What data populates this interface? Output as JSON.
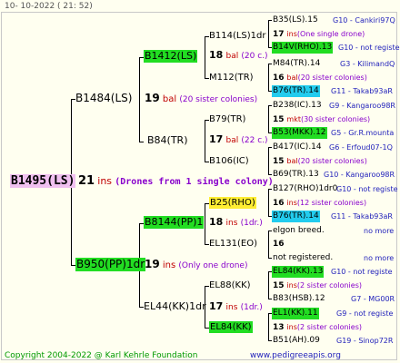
{
  "header_date": "10-  10-2022  ( 21: 52)",
  "footer": {
    "copyright": "Copyright 2004-2022 @ Karl Kehrle Foundation",
    "url": "www.pedigreeapis.org"
  },
  "root": {
    "name": "B1495(LS)",
    "count": "21",
    "unit": "ins",
    "note": "(Drones from 1 single colony)"
  },
  "gen1": [
    {
      "name": "B1484(LS)",
      "count": "19",
      "unit": "bal",
      "note": "(20 sister colonies)"
    },
    {
      "name": "B950(PP)1dr",
      "count": "19",
      "unit": "ins",
      "note": "(Only one drone)"
    }
  ],
  "gen2": [
    {
      "name": "B1412(LS)",
      "count": "18",
      "unit": "bal",
      "note": "(20 c.)"
    },
    {
      "name": "B84(TR)",
      "count": "17",
      "unit": "bal",
      "note": "(22 c.)"
    },
    {
      "name": "B8144(PP)1",
      "count": "18",
      "unit": "ins",
      "note": "(1dr.)"
    },
    {
      "name": "EL44(KK)1dr",
      "count": "17",
      "unit": "ins",
      "note": "(1dr.)"
    }
  ],
  "gen3": [
    {
      "name": "B114(LS)1dr"
    },
    {
      "name": "M112(TR)"
    },
    {
      "name": "B79(TR)"
    },
    {
      "name": "B106(IC)"
    },
    {
      "name": "B25(RHO)"
    },
    {
      "name": "EL131(EO)"
    },
    {
      "name": "EL88(KK)"
    },
    {
      "name": "EL84(KK)"
    }
  ],
  "gen4": [
    {
      "name": "B35(LS).15",
      "right": "G10 - Cankiri97Q"
    },
    {
      "count": "17",
      "unit": "ins",
      "note": "(One single drone)"
    },
    {
      "name": "B14V(RHO).13",
      "right": "G10 - not registe"
    },
    {
      "name": "M84(TR).14",
      "right": "G3 - KilimandQ"
    },
    {
      "count": "16",
      "unit": "bal",
      "note": "(20 sister colonies)"
    },
    {
      "name": "B76(TR).14",
      "right": "G11 - Takab93aR"
    },
    {
      "name": "B238(IC).13",
      "right": "G9 - Kangaroo98R"
    },
    {
      "count": "15",
      "unit": "mkt",
      "note": "(30 sister colonies)"
    },
    {
      "name": "B53(MKK).12",
      "right": "G5 - Gr.R.mounta"
    },
    {
      "name": "B417(IC).14",
      "right": "G6 - Erfoud07-1Q"
    },
    {
      "count": "15",
      "unit": "bal",
      "note": "(20 sister colonies)"
    },
    {
      "name": "B69(TR).13",
      "right": "G10 - Kangaroo98R"
    },
    {
      "name": "B127(RHO)1dr0",
      "right": "G10 - not registe"
    },
    {
      "count": "16",
      "unit": "ins",
      "note": "(12 sister colonies)"
    },
    {
      "name": "B76(TR).14",
      "right": "G11 - Takab93aR"
    },
    {
      "name": "elgon breed.",
      "right": "no more"
    },
    {
      "count": "16"
    },
    {
      "name": "not registered.",
      "right": "no more"
    },
    {
      "name": "EL84(KK).13",
      "right": "G10 - not registe"
    },
    {
      "count": "15",
      "unit": "ins",
      "note": "(2 sister colonies)"
    },
    {
      "name": "B83(HSB).12",
      "right": "G7 - MG00R"
    },
    {
      "name": "EL1(KK).11",
      "right": "G9 - not registe"
    },
    {
      "count": "13",
      "unit": "ins",
      "note": "(2 sister colonies)"
    },
    {
      "name": "B51(AH).09",
      "right": "G19 - Sinop72R"
    }
  ]
}
